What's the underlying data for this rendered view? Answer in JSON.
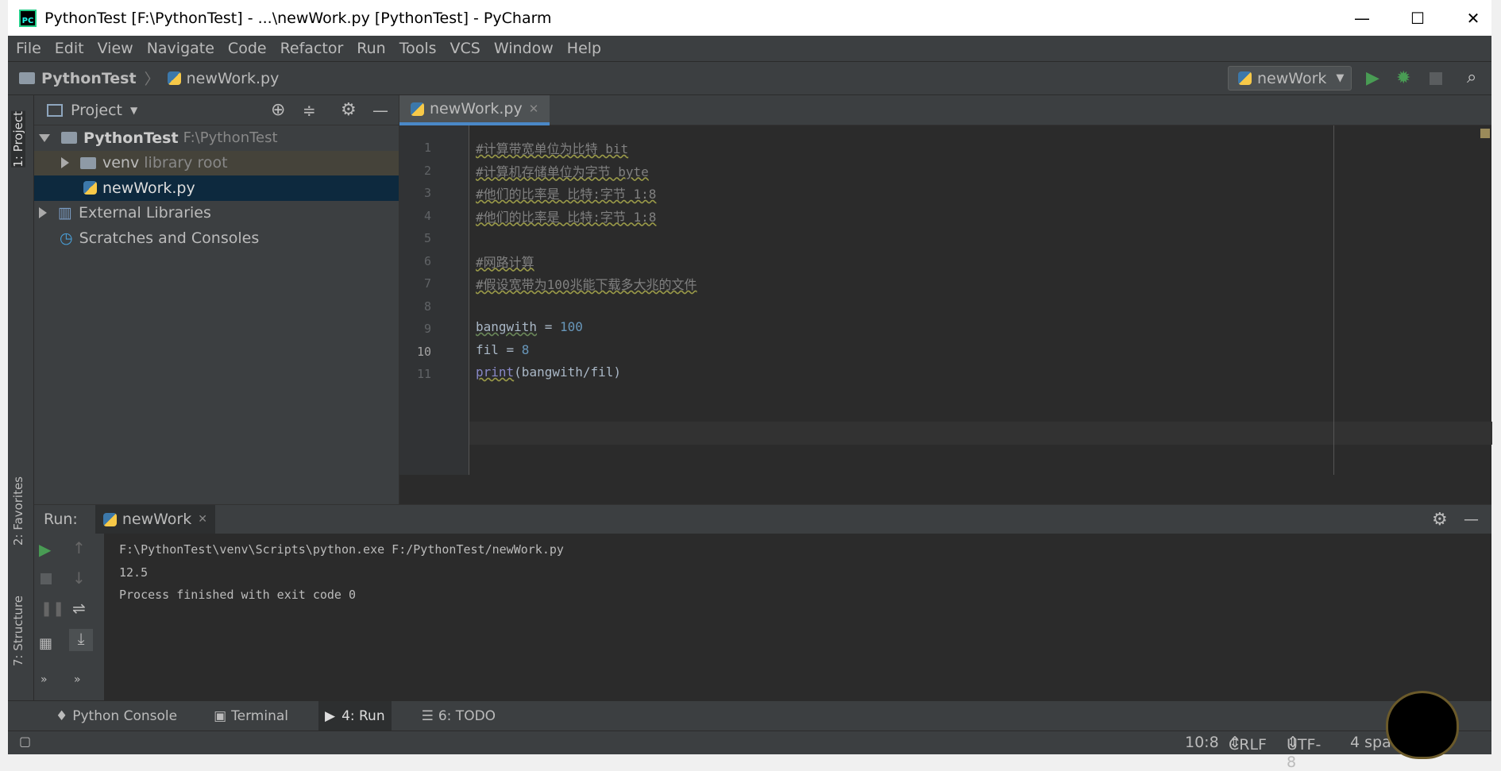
{
  "window": {
    "title": "PythonTest [F:\\PythonTest] - ...\\newWork.py [PythonTest] - PyCharm",
    "app_icon": "PC"
  },
  "menu": [
    "File",
    "Edit",
    "View",
    "Navigate",
    "Code",
    "Refactor",
    "Run",
    "Tools",
    "VCS",
    "Window",
    "Help"
  ],
  "breadcrumb": {
    "project": "PythonTest",
    "file": "newWork.py"
  },
  "run_config": "newWork",
  "side_labels": {
    "project": "1: Project",
    "favorites": "2: Favorites",
    "structure": "7: Structure"
  },
  "project_panel": {
    "title": "Project",
    "tree": [
      {
        "name": "PythonTest",
        "detail": "F:\\PythonTest"
      },
      {
        "name": "venv",
        "detail": "library root"
      },
      {
        "name": "newWork.py",
        "detail": ""
      },
      {
        "name": "External Libraries",
        "detail": ""
      },
      {
        "name": "Scratches and Consoles",
        "detail": ""
      }
    ]
  },
  "editor": {
    "tab": "newWork.py",
    "lines": [
      "#计算带宽单位为比特 bit",
      "#计算机存储单位为字节 byte",
      "#他们的比率是 比特:字节 1:8",
      "#他们的比率是 比特:字节 1:8",
      "",
      "#网路计算",
      "#假设宽带为100兆能下载多大兆的文件",
      "",
      "bangwith = 100",
      "fil = 8",
      "print(bangwith/fil)"
    ],
    "line_numbers": [
      "1",
      "2",
      "3",
      "4",
      "5",
      "6",
      "7",
      "8",
      "9",
      "10",
      "11"
    ]
  },
  "run": {
    "label": "Run:",
    "tab": "newWork",
    "output": [
      "F:\\PythonTest\\venv\\Scripts\\python.exe F:/PythonTest/newWork.py",
      "12.5",
      "",
      "Process finished with exit code 0"
    ]
  },
  "tool_windows": [
    "Python Console",
    "Terminal",
    "4: Run",
    "6: TODO"
  ],
  "status": {
    "position": "10:8",
    "line_sep": "CRLF",
    "encoding": "UTF-8",
    "indent": "4 spa"
  },
  "colors": {
    "accent": "#4a88c7",
    "run_green": "#499c54",
    "bg": "#2b2b2b",
    "panel": "#3c3f41"
  }
}
